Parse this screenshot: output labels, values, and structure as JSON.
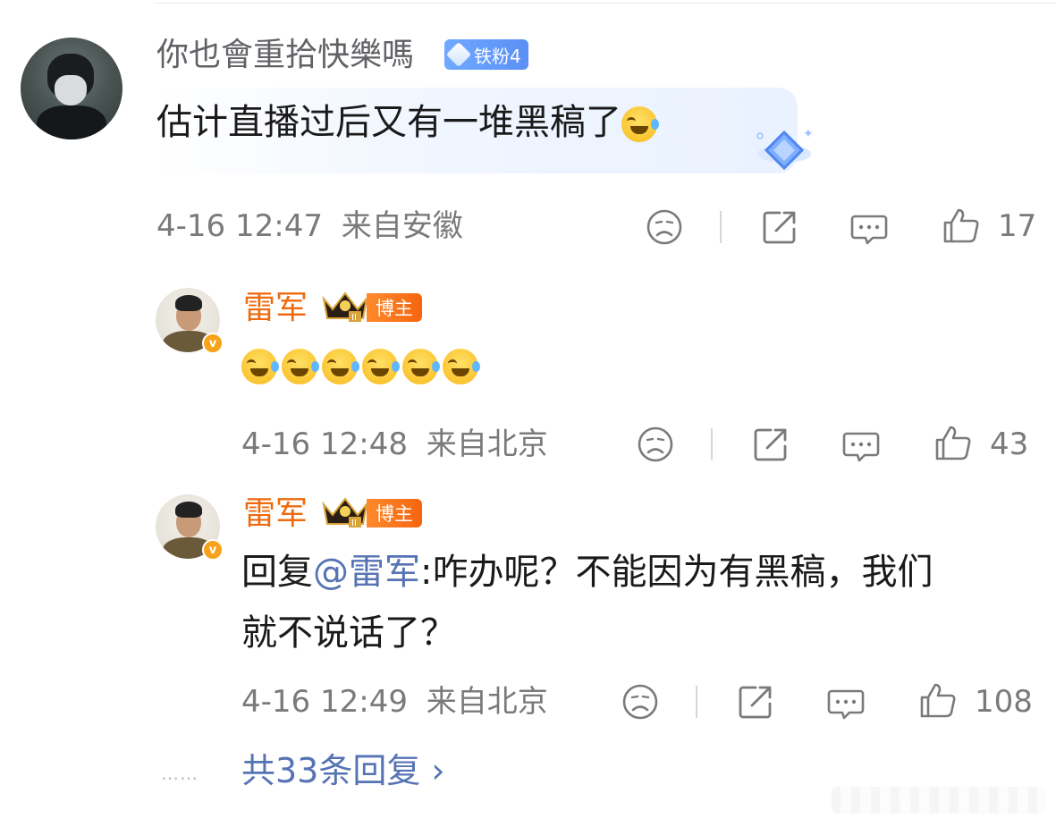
{
  "main_comment": {
    "username": "你也會重拾快樂嗎",
    "fan_badge": "铁粉4",
    "text": "估计直播过后又有一堆黑稿了",
    "emoji": "laugh-cry",
    "time": "4-16 12:47",
    "location": "来自安徽",
    "likes": "17"
  },
  "replies": [
    {
      "username": "雷军",
      "role_badge": "博主",
      "text": "",
      "emoji_count": 6,
      "time": "4-16 12:48",
      "location": "来自北京",
      "likes": "43"
    },
    {
      "username": "雷军",
      "role_badge": "博主",
      "reply_prefix": "回复",
      "mention": "@雷军",
      "text_line1": ":咋办呢？不能因为有黑稿，我们",
      "text_line2": "就不说话了？",
      "time": "4-16 12:49",
      "location": "来自北京",
      "likes": "108"
    }
  ],
  "footer": {
    "dots": "……",
    "more_replies": "共33条回复 ›"
  },
  "colors": {
    "accent_orange": "#ee6a0c",
    "link_blue": "#5673b4",
    "meta_gray": "#7a7a7a"
  }
}
